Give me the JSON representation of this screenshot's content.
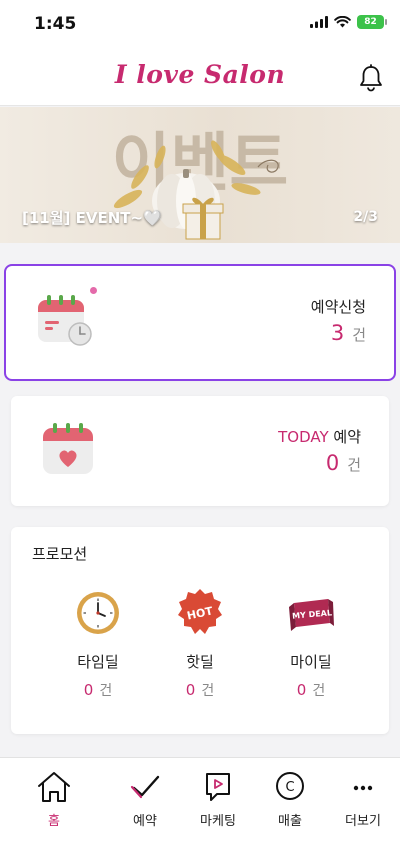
{
  "status": {
    "time": "1:45",
    "battery": "82"
  },
  "header": {
    "title": "I love Salon",
    "bell_icon": "bell-icon"
  },
  "banner": {
    "caption": "[11월] EVENT~🤍",
    "page": "2/3",
    "art_text": "이벤트"
  },
  "reservation": {
    "label": "예약신청",
    "count": "3",
    "unit": "건"
  },
  "today": {
    "accent": "TODAY",
    "label": " 예약",
    "count": "0",
    "unit": "건"
  },
  "promotion": {
    "title": "프로모션",
    "items": [
      {
        "label": "타임딜",
        "count": "0",
        "unit": "건",
        "icon": "clock-icon"
      },
      {
        "label": "핫딜",
        "count": "0",
        "unit": "건",
        "icon": "hot-badge-icon",
        "badge_text": "HOT"
      },
      {
        "label": "마이딜",
        "count": "0",
        "unit": "건",
        "icon": "my-deal-icon",
        "badge_text": "MY DEAL"
      }
    ]
  },
  "tabs": [
    {
      "label": "홈",
      "icon": "home-icon",
      "active": true
    },
    {
      "label": "예약",
      "icon": "check-icon",
      "active": false
    },
    {
      "label": "마케팅",
      "icon": "marketing-play-icon",
      "active": false
    },
    {
      "label": "매출",
      "icon": "coin-c-icon",
      "active": false,
      "icon_text": "C"
    },
    {
      "label": "더보기",
      "icon": "more-dots-icon",
      "active": false
    }
  ],
  "colors": {
    "brand": "#c72a6f",
    "selection": "#8a42e6",
    "calendar": "#e26472"
  }
}
